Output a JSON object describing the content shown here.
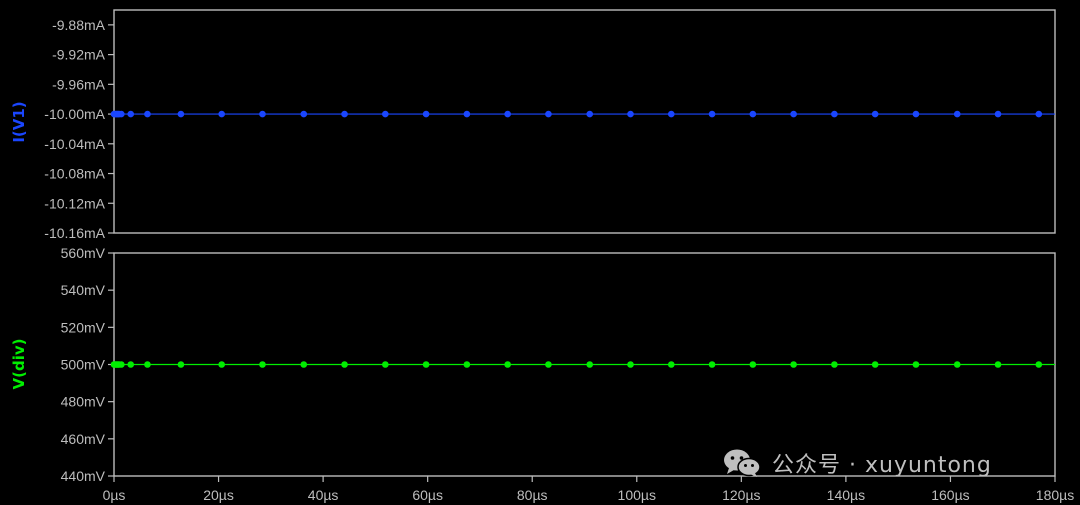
{
  "chart_data": [
    {
      "type": "line",
      "ylabel": "I(V1)",
      "ylabel_color": "#1a46ff",
      "series_color": "#1a46ff",
      "ylim": [
        -10.16,
        -9.86
      ],
      "yticks": [
        -9.88,
        -9.92,
        -9.96,
        -10.0,
        -10.04,
        -10.08,
        -10.12,
        -10.16
      ],
      "ytick_labels": [
        "-9.88mA",
        "-9.92mA",
        "-9.96mA",
        "-10.00mA",
        "-10.04mA",
        "-10.08mA",
        "-10.12mA",
        "-10.16mA"
      ],
      "series": [
        {
          "x": [
            0,
            0.2,
            0.4,
            0.6,
            0.8,
            1.0,
            1.4,
            3.2,
            6.4,
            12.8,
            20.6,
            28.4,
            36.3,
            44.1,
            51.9,
            59.7,
            67.5,
            75.3,
            83.1,
            91.0,
            98.8,
            106.6,
            114.4,
            122.2,
            130.0,
            137.8,
            145.6,
            153.4,
            161.3,
            169.1,
            176.9
          ],
          "values": [
            -10.0,
            -10.0,
            -10.0,
            -10.0,
            -10.0,
            -10.0,
            -10.0,
            -10.0,
            -10.0,
            -10.0,
            -10.0,
            -10.0,
            -10.0,
            -10.0,
            -10.0,
            -10.0,
            -10.0,
            -10.0,
            -10.0,
            -10.0,
            -10.0,
            -10.0,
            -10.0,
            -10.0,
            -10.0,
            -10.0,
            -10.0,
            -10.0,
            -10.0,
            -10.0,
            -10.0
          ]
        }
      ]
    },
    {
      "type": "line",
      "ylabel": "V(div)",
      "ylabel_color": "#00ee00",
      "series_color": "#00ee00",
      "ylim": [
        440,
        560
      ],
      "yticks": [
        560,
        540,
        520,
        500,
        480,
        460,
        440
      ],
      "ytick_labels": [
        "560mV",
        "540mV",
        "520mV",
        "500mV",
        "480mV",
        "460mV",
        "440mV"
      ],
      "series": [
        {
          "x": [
            0,
            0.2,
            0.4,
            0.6,
            0.8,
            1.0,
            1.4,
            3.2,
            6.4,
            12.8,
            20.6,
            28.4,
            36.3,
            44.1,
            51.9,
            59.7,
            67.5,
            75.3,
            83.1,
            91.0,
            98.8,
            106.6,
            114.4,
            122.2,
            130.0,
            137.8,
            145.6,
            153.4,
            161.3,
            169.1,
            176.9
          ],
          "values": [
            500,
            500,
            500,
            500,
            500,
            500,
            500,
            500,
            500,
            500,
            500,
            500,
            500,
            500,
            500,
            500,
            500,
            500,
            500,
            500,
            500,
            500,
            500,
            500,
            500,
            500,
            500,
            500,
            500,
            500,
            500
          ]
        }
      ]
    }
  ],
  "x_axis": {
    "xlim": [
      0,
      180
    ],
    "ticks": [
      0,
      20,
      40,
      60,
      80,
      100,
      120,
      140,
      160,
      180
    ],
    "tick_labels": [
      "0µs",
      "20µs",
      "40µs",
      "60µs",
      "80µs",
      "100µs",
      "120µs",
      "140µs",
      "160µs",
      "180µs"
    ]
  },
  "watermark": {
    "text": "公众号 · xuyuntong",
    "icon": "wechat-icon"
  },
  "colors": {
    "background": "#000000",
    "frame": "#bdbdbd",
    "text": "#bdbdbd"
  }
}
